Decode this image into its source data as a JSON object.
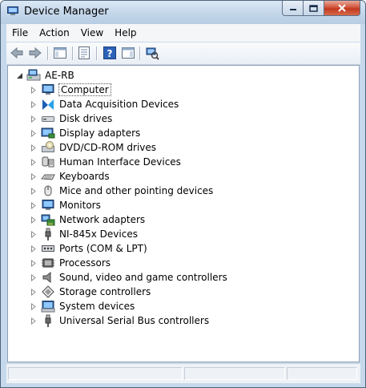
{
  "window": {
    "title": "Device Manager",
    "app_icon": "device-manager-icon",
    "controls": [
      "minimize-icon",
      "maximize-icon",
      "close-icon"
    ]
  },
  "menu": {
    "items": [
      {
        "label": "File"
      },
      {
        "label": "Action"
      },
      {
        "label": "View"
      },
      {
        "label": "Help"
      }
    ]
  },
  "toolbar": {
    "buttons": [
      "back-arrow-icon",
      "forward-arrow-icon",
      "show-hide-console-tree-icon",
      "properties-icon",
      "help-icon",
      "action-pane-icon",
      "scan-hardware-icon"
    ]
  },
  "tree": {
    "root": {
      "label": "AE-RB",
      "icon": "computer-root-icon",
      "expanded": true
    },
    "items": [
      {
        "label": "Computer",
        "icon": "computer-icon",
        "selected": true
      },
      {
        "label": "Data Acquisition Devices",
        "icon": "ni-logo-icon"
      },
      {
        "label": "Disk drives",
        "icon": "disk-drive-icon"
      },
      {
        "label": "Display adapters",
        "icon": "display-adapter-icon"
      },
      {
        "label": "DVD/CD-ROM drives",
        "icon": "dvd-drive-icon"
      },
      {
        "label": "Human Interface Devices",
        "icon": "hid-icon"
      },
      {
        "label": "Keyboards",
        "icon": "keyboard-icon"
      },
      {
        "label": "Mice and other pointing devices",
        "icon": "mouse-icon"
      },
      {
        "label": "Monitors",
        "icon": "monitor-icon"
      },
      {
        "label": "Network adapters",
        "icon": "network-adapter-icon"
      },
      {
        "label": "NI-845x Devices",
        "icon": "usb-plug-icon"
      },
      {
        "label": "Ports (COM & LPT)",
        "icon": "port-icon"
      },
      {
        "label": "Processors",
        "icon": "processor-icon"
      },
      {
        "label": "Sound, video and game controllers",
        "icon": "speaker-icon"
      },
      {
        "label": "Storage controllers",
        "icon": "storage-controller-icon"
      },
      {
        "label": "System devices",
        "icon": "system-device-icon"
      },
      {
        "label": "Universal Serial Bus controllers",
        "icon": "usb-plug-icon"
      }
    ]
  },
  "colors": {
    "title_bar": "#c3d6ea",
    "close_button": "#c2391f",
    "tree_background": "#ffffff"
  }
}
